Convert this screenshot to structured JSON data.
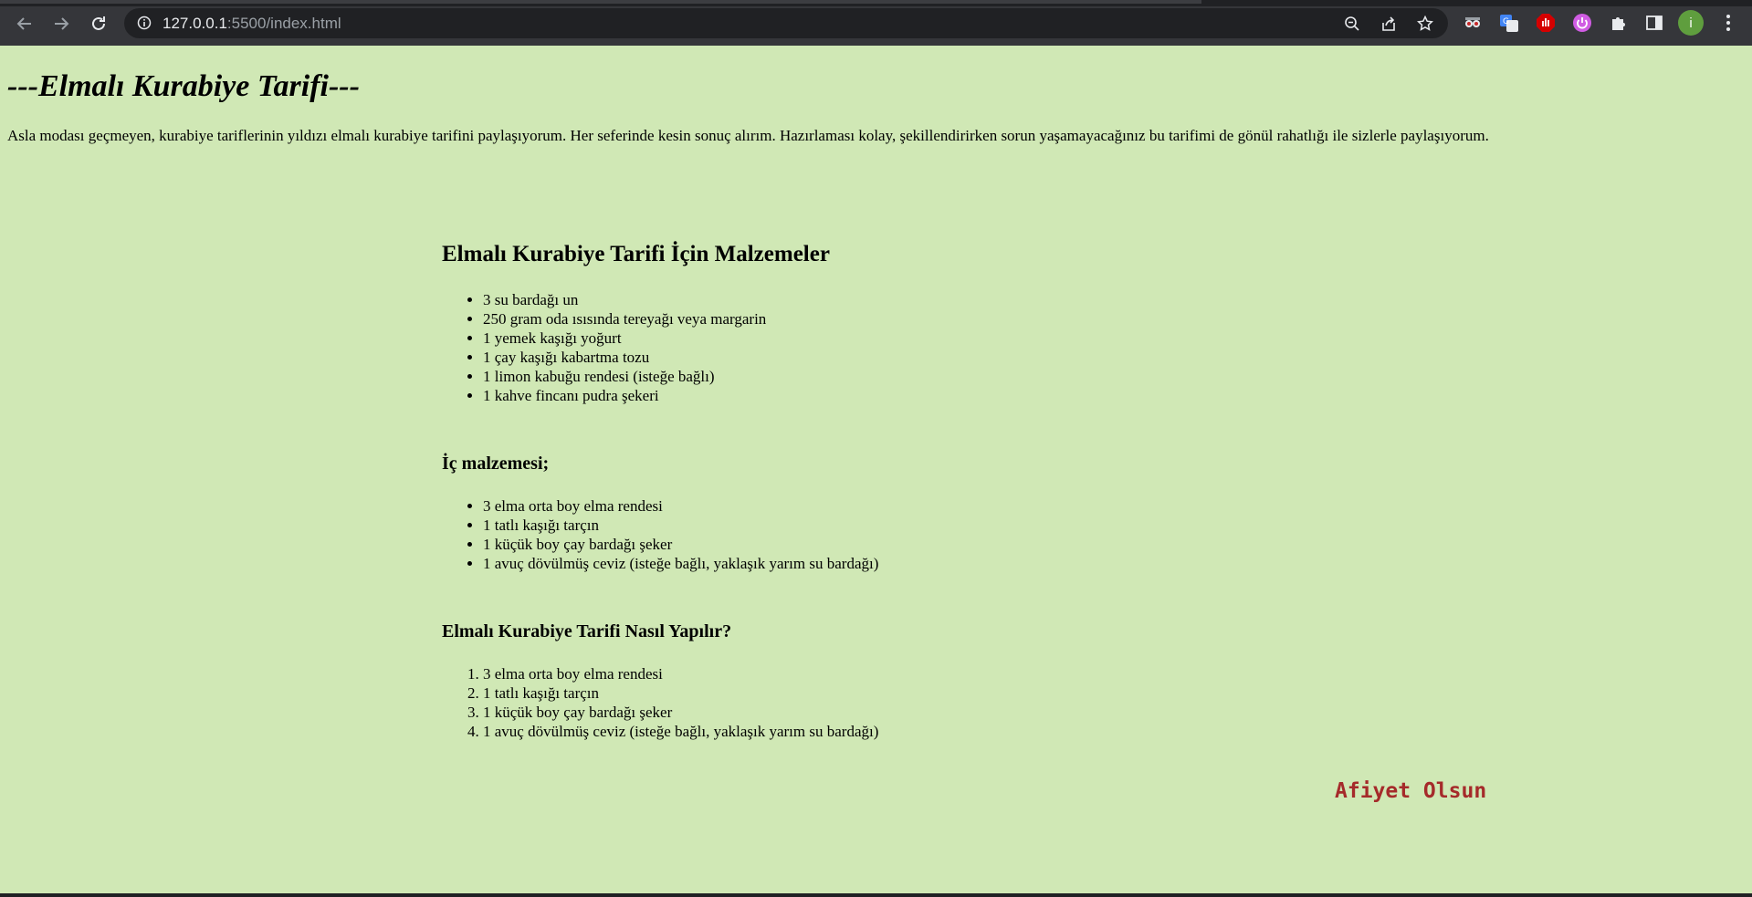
{
  "browser": {
    "url_host": "127.0.0.1",
    "url_path": ":5500/index.html",
    "profile_initial": "i",
    "icons": {
      "back": "arrow-left-icon",
      "forward": "arrow-right-icon",
      "reload": "reload-icon",
      "site_info": "info-icon",
      "zoom": "zoom-out-icon",
      "share": "share-icon",
      "bookmark": "star-icon",
      "extensions": "puzzle-icon",
      "side_panel": "side-panel-icon",
      "menu": "kebab-menu-icon"
    }
  },
  "page": {
    "background": "#d0e8b5",
    "title": "---Elmalı Kurabiye Tarifi---",
    "intro": "Asla modası geçmeyen, kurabiye tariflerinin yıldızı elmalı kurabiye tarifini paylaşıyorum. Her seferinde kesin sonuç alırım. Hazırlaması kolay, şekillendirirken sorun yaşamayacağınız bu tarifimi de gönül rahatlığı ile sizlerle paylaşıyorum.",
    "ingredients": {
      "heading": "Elmalı Kurabiye Tarifi İçin Malzemeler",
      "items": [
        "3 su bardağı un",
        "250 gram oda ısısında tereyağı veya margarin",
        "1 yemek kaşığı yoğurt",
        "1 çay kaşığı kabartma tozu",
        "1 limon kabuğu rendesi (isteğe bağlı)",
        "1 kahve fincanı pudra şekeri"
      ]
    },
    "filling": {
      "heading": "İç malzemesi;",
      "items": [
        "3 elma orta boy elma rendesi",
        "1 tatlı kaşığı tarçın",
        "1 küçük boy çay bardağı şeker",
        "1 avuç dövülmüş ceviz (isteğe bağlı, yaklaşık yarım su bardağı)"
      ]
    },
    "steps": {
      "heading": "Elmalı Kurabiye Tarifi Nasıl Yapılır?",
      "items": [
        "3 elma orta boy elma rendesi",
        "1 tatlı kaşığı tarçın",
        "1 küçük boy çay bardağı şeker",
        "1 avuç dövülmüş ceviz (isteğe bağlı, yaklaşık yarım su bardağı)"
      ]
    },
    "signoff": "Afiyet Olsun",
    "signoff_color": "#a52a2a"
  }
}
